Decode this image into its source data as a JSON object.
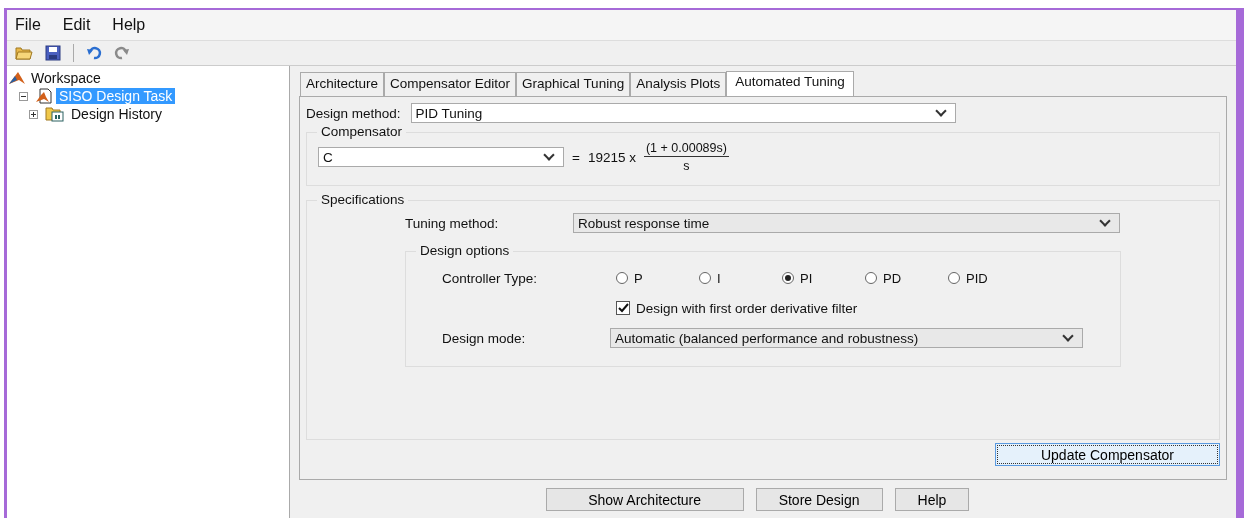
{
  "menu": [
    "File",
    "Edit",
    "Help"
  ],
  "toolbar": [
    {
      "kind": "open",
      "disabled": false
    },
    {
      "kind": "save",
      "disabled": false
    },
    {
      "kind": "undo",
      "disabled": false
    },
    {
      "kind": "redo",
      "disabled": true
    }
  ],
  "tree": [
    {
      "label": "Workspace",
      "kind": "workspace",
      "selected": false,
      "children": [
        {
          "label": "SISO Design Task",
          "kind": "task",
          "selected": true,
          "expanded": true,
          "children": [
            {
              "label": "Design History",
              "kind": "folder",
              "selected": false,
              "expanded": false
            }
          ]
        }
      ]
    }
  ],
  "tabs": [
    {
      "label": "Architecture",
      "selected": false
    },
    {
      "label": "Compensator Editor",
      "selected": false
    },
    {
      "label": "Graphical Tuning",
      "selected": false
    },
    {
      "label": "Analysis Plots",
      "selected": false
    },
    {
      "label": "Automated Tuning",
      "selected": true
    }
  ],
  "design_method": {
    "label": "Design method:",
    "value": "PID Tuning"
  },
  "compensator": {
    "title": "Compensator",
    "value": "C",
    "equals": "=",
    "gain": "19215 x",
    "numerator": "(1 + 0.00089s)",
    "denominator": "s"
  },
  "specifications": {
    "title": "Specifications",
    "tuning_method": {
      "label": "Tuning method:",
      "value": "Robust response time"
    },
    "design_options": {
      "title": "Design options",
      "controller_type": {
        "label": "Controller Type:",
        "options": [
          {
            "label": "P",
            "selected": false
          },
          {
            "label": "I",
            "selected": false
          },
          {
            "label": "PI",
            "selected": true
          },
          {
            "label": "PD",
            "selected": false
          },
          {
            "label": "PID",
            "selected": false
          }
        ]
      },
      "filter": {
        "label": "Design with first order derivative filter",
        "checked": true
      },
      "design_mode": {
        "label": "Design mode:",
        "value": "Automatic (balanced performance and robustness)"
      }
    }
  },
  "update_button": "Update Compensator",
  "buttons": [
    "Show Architecture",
    "Store Design",
    "Help"
  ]
}
